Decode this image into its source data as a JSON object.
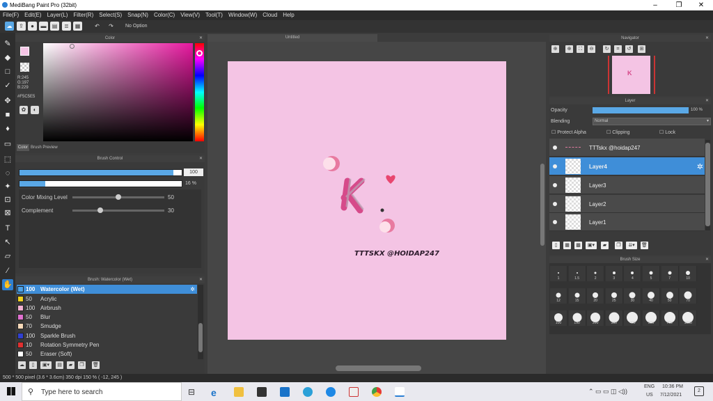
{
  "window": {
    "title": "MediBang Paint Pro (32bit)",
    "minimize": "–",
    "maximize": "❐",
    "close": "✕"
  },
  "menu": [
    "File(F)",
    "Edit(E)",
    "Layer(L)",
    "Filter(R)",
    "Select(S)",
    "Snap(N)",
    "Color(C)",
    "View(V)",
    "Tool(T)",
    "Window(W)",
    "Cloud",
    "Help"
  ],
  "toolbar": {
    "option": "No Option"
  },
  "color_panel": {
    "title": "Color",
    "readout": "R:245\nG:197\nB:229",
    "hex": "#F5C5E5",
    "tab_color": "Color",
    "tab_preview": "Brush Preview",
    "fg": "#f5c5e5",
    "bg": "#43a6f0"
  },
  "brush_control": {
    "title": "Brush Control",
    "size_value": "100",
    "opacity_value": "16 %",
    "size_fill": 0.95,
    "opacity_fill": 0.16,
    "mixing_label": "Color Mixing Level",
    "mixing_value": "50",
    "mixing_pos": 0.5,
    "complement_label": "Complement",
    "complement_value": "30",
    "complement_pos": 0.3
  },
  "brush_list": {
    "title": "Brush: Watercolor (Wet)",
    "items": [
      {
        "size": "100",
        "name": "Watercolor (Wet)",
        "color": "#4da3e8"
      },
      {
        "size": "50",
        "name": "Acrylic",
        "color": "#f0d020"
      },
      {
        "size": "100",
        "name": "Airbrush",
        "color": "#f0b0d0"
      },
      {
        "size": "50",
        "name": "Blur",
        "color": "#e070d0"
      },
      {
        "size": "70",
        "name": "Smudge",
        "color": "#f5d8b8"
      },
      {
        "size": "100",
        "name": "Sparkle Brush",
        "color": "#3040d0"
      },
      {
        "size": "10",
        "name": "Rotation Symmetry Pen",
        "color": "#e03030"
      },
      {
        "size": "50",
        "name": "Eraser (Soft)",
        "color": "#ffffff"
      }
    ]
  },
  "canvas": {
    "tab": "Untitled",
    "bg": "#f4c4e4",
    "text": "TTTSKX @HOIDAP247"
  },
  "navigator": {
    "title": "Navigator"
  },
  "layer_panel": {
    "title": "Layer",
    "opacity_label": "Opacity",
    "opacity_value": "100 %",
    "blending_label": "Blending",
    "blending_value": "Normal",
    "protect_alpha": "Protect Alpha",
    "clipping": "Clipping",
    "lock": "Lock",
    "layers": [
      "TTTskx @hoidap247",
      "Layer4",
      "Layer3",
      "Layer2",
      "Layer1"
    ]
  },
  "brush_size": {
    "title": "Brush Size",
    "sizes": [
      "1",
      "1.5",
      "2",
      "3",
      "4",
      "5",
      "7",
      "10",
      "12",
      "15",
      "20",
      "25",
      "30",
      "40",
      "50",
      "70",
      "100",
      "150",
      "200",
      "300",
      "400",
      "500",
      "700",
      "1000"
    ]
  },
  "status": {
    "text": "500 * 500 pixel   (3.6 * 3.6cm)   350 dpi   150 %   ( -12, 245 )"
  },
  "taskbar": {
    "search": "Type here to search",
    "lang1": "ENG",
    "lang2": "US",
    "time": "10:36 PM",
    "date": "7/12/2021",
    "notif": "2"
  }
}
